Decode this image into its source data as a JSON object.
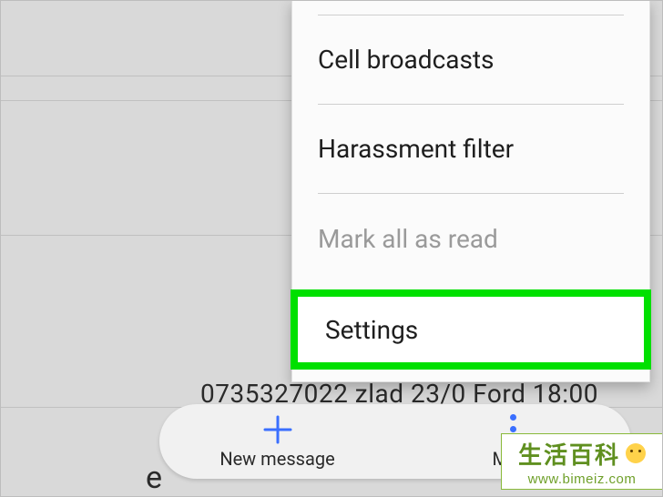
{
  "menu": {
    "items": [
      {
        "label": "Cell broadcasts",
        "enabled": true
      },
      {
        "label": "Harassment filter",
        "enabled": true
      },
      {
        "label": "Mark all as read",
        "enabled": false
      },
      {
        "label": "Settings",
        "enabled": true,
        "highlighted": true
      }
    ]
  },
  "pill": {
    "new_message": "New message",
    "more": "More"
  },
  "background": {
    "line_text": "0735327022 zlad 23/0 Ford 18:00",
    "side_letter": "e"
  },
  "watermark": {
    "title": "生活百科",
    "url": "www.bimeiz.com"
  }
}
